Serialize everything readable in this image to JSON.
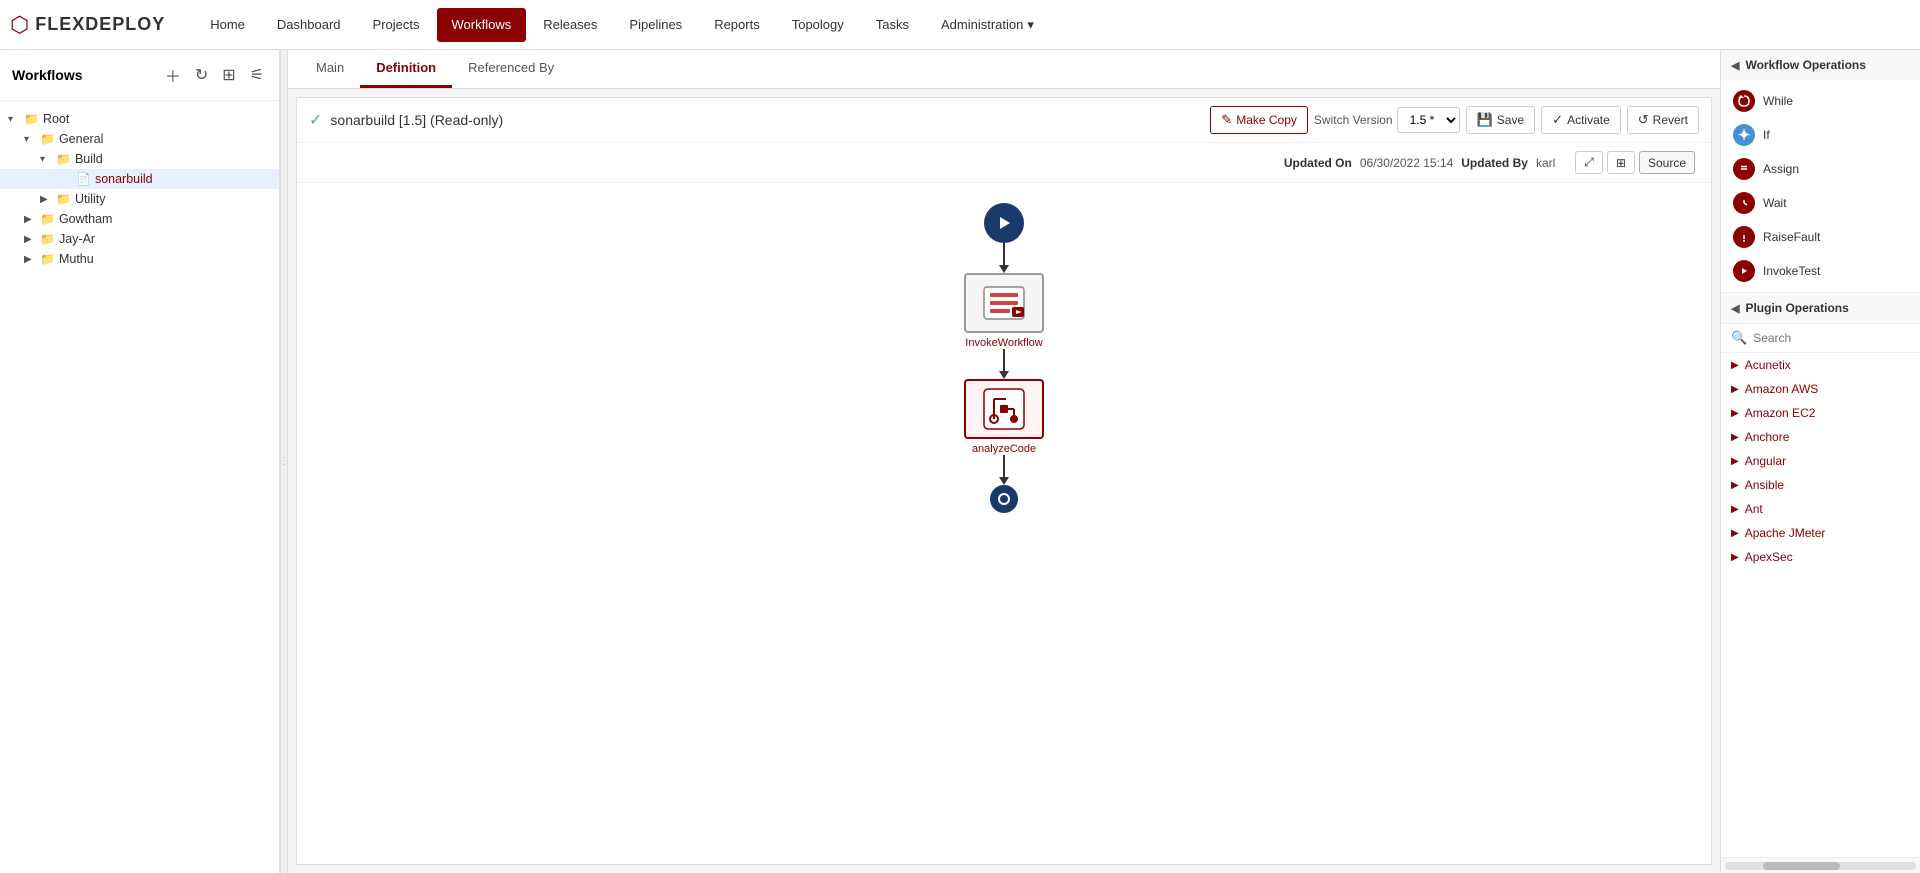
{
  "logo": {
    "icon": "▶",
    "text": "FLEXDEPLOY"
  },
  "nav": {
    "items": [
      {
        "id": "home",
        "label": "Home",
        "active": false
      },
      {
        "id": "dashboard",
        "label": "Dashboard",
        "active": false
      },
      {
        "id": "projects",
        "label": "Projects",
        "active": false
      },
      {
        "id": "workflows",
        "label": "Workflows",
        "active": true
      },
      {
        "id": "releases",
        "label": "Releases",
        "active": false
      },
      {
        "id": "pipelines",
        "label": "Pipelines",
        "active": false
      },
      {
        "id": "reports",
        "label": "Reports",
        "active": false
      },
      {
        "id": "topology",
        "label": "Topology",
        "active": false
      },
      {
        "id": "tasks",
        "label": "Tasks",
        "active": false
      },
      {
        "id": "administration",
        "label": "Administration",
        "active": false,
        "hasDropdown": true
      }
    ]
  },
  "sidebar": {
    "title": "Workflows",
    "tree": [
      {
        "id": "root",
        "label": "Root",
        "level": 0,
        "expanded": true,
        "type": "folder"
      },
      {
        "id": "general",
        "label": "General",
        "level": 1,
        "expanded": true,
        "type": "folder"
      },
      {
        "id": "build",
        "label": "Build",
        "level": 2,
        "expanded": true,
        "type": "folder"
      },
      {
        "id": "sonarbuild",
        "label": "sonarbuild",
        "level": 3,
        "expanded": false,
        "type": "leaf",
        "selected": true
      },
      {
        "id": "utility",
        "label": "Utility",
        "level": 2,
        "expanded": false,
        "type": "folder"
      },
      {
        "id": "gowtham",
        "label": "Gowtham",
        "level": 1,
        "expanded": false,
        "type": "folder"
      },
      {
        "id": "jay-ar",
        "label": "Jay-Ar",
        "level": 1,
        "expanded": false,
        "type": "folder"
      },
      {
        "id": "muthu",
        "label": "Muthu",
        "level": 1,
        "expanded": false,
        "type": "folder"
      }
    ]
  },
  "tabs": {
    "items": [
      {
        "id": "main",
        "label": "Main",
        "active": false
      },
      {
        "id": "definition",
        "label": "Definition",
        "active": true
      },
      {
        "id": "referenced_by",
        "label": "Referenced By",
        "active": false
      }
    ]
  },
  "workflow": {
    "check_icon": "✓",
    "title": "sonarbuild [1.5] (Read-only)",
    "make_copy_label": "Make Copy",
    "switch_version_label": "Switch Version",
    "version_value": "1.5 *",
    "save_label": "Save",
    "activate_label": "Activate",
    "revert_label": "Revert",
    "updated_on_label": "Updated On",
    "updated_on_value": "06/30/2022 15:14",
    "updated_by_label": "Updated By",
    "updated_by_value": "karl",
    "source_label": "Source",
    "diagram": {
      "nodes": [
        {
          "id": "start",
          "type": "start"
        },
        {
          "id": "invoke_workflow",
          "type": "task",
          "label": "InvokeWorkflow",
          "icon_type": "invoke"
        },
        {
          "id": "analyze_code",
          "type": "task",
          "label": "analyzeCode",
          "icon_type": "analyze"
        },
        {
          "id": "end",
          "type": "end"
        }
      ]
    }
  },
  "workflow_operations": {
    "title": "Workflow Operations",
    "items": [
      {
        "id": "while",
        "label": "While",
        "icon_type": "while"
      },
      {
        "id": "if",
        "label": "If",
        "icon_type": "if"
      },
      {
        "id": "assign",
        "label": "Assign",
        "icon_type": "assign"
      },
      {
        "id": "wait",
        "label": "Wait",
        "icon_type": "wait"
      },
      {
        "id": "raise_fault",
        "label": "RaiseFault",
        "icon_type": "raise"
      },
      {
        "id": "invoke_test",
        "label": "InvokeTest",
        "icon_type": "invoke_test"
      }
    ]
  },
  "plugin_operations": {
    "title": "Plugin Operations",
    "search_placeholder": "Search",
    "items": [
      {
        "id": "acunetix",
        "label": "Acunetix"
      },
      {
        "id": "amazon_aws",
        "label": "Amazon AWS"
      },
      {
        "id": "amazon_ec2",
        "label": "Amazon EC2"
      },
      {
        "id": "anchore",
        "label": "Anchore"
      },
      {
        "id": "angular",
        "label": "Angular"
      },
      {
        "id": "ansible",
        "label": "Ansible"
      },
      {
        "id": "ant",
        "label": "Ant"
      },
      {
        "id": "apache_jmeter",
        "label": "Apache JMeter"
      },
      {
        "id": "apexsec",
        "label": "ApexSec"
      }
    ]
  },
  "colors": {
    "brand_red": "#8b0000",
    "nav_bg": "#8b0000",
    "dark_blue": "#1a3a6b"
  }
}
